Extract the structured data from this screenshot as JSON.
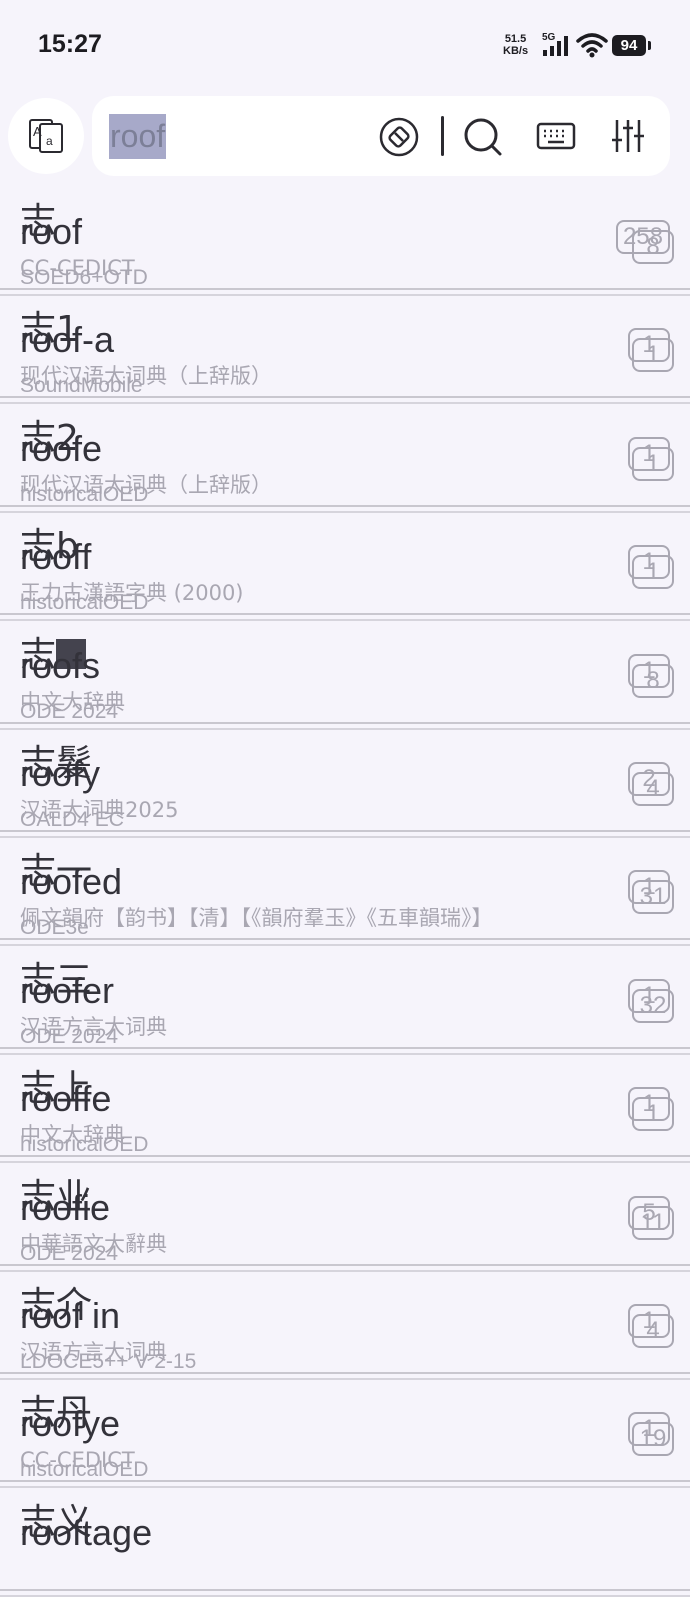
{
  "status_bar": {
    "time": "15:27",
    "net_speed_value": "51.5",
    "net_speed_unit": "KB/s",
    "signal_label": "5G",
    "battery": "94"
  },
  "search": {
    "query": "roof"
  },
  "results": [
    {
      "ghost_headword": "志",
      "headword": "roof",
      "ghost_dict": "CC-CEDICT",
      "dict": "SOED6+OTD",
      "ghost_count": "258",
      "count": "8"
    },
    {
      "ghost_headword": "志1",
      "headword": "roof-a",
      "ghost_dict": "现代汉语大词典（上辞版）",
      "dict": "SoundMobile",
      "ghost_count": "1",
      "count": "1"
    },
    {
      "ghost_headword": "志2",
      "headword": "roofe",
      "ghost_dict": "现代汉语大词典（上辞版）",
      "dict": "historicalOED",
      "ghost_count": "1",
      "count": "1"
    },
    {
      "ghost_headword": "志b",
      "headword": "rooff",
      "ghost_dict": "王力古漢語字典 (2000)",
      "dict": "historicalOED",
      "ghost_count": "1",
      "count": "1"
    },
    {
      "ghost_headword": "志",
      "ghost_square": true,
      "headword": "roofs",
      "ghost_dict": "中文大辞典",
      "dict": "ODE 2024",
      "ghost_count": "1",
      "count": "8"
    },
    {
      "ghost_headword": "志髮",
      "headword": "roofy",
      "ghost_dict": "汉语大词典2025",
      "dict": "OALD4 EC",
      "ghost_count": "2",
      "count": "4"
    },
    {
      "ghost_headword": "志一",
      "headword": "roofed",
      "ghost_dict": "佩文韻府【韵书】【清】【《韻府羣玉》《五車韻瑞》】",
      "dict": "ODE3e",
      "ghost_count": "1",
      "count": "31"
    },
    {
      "ghost_headword": "志三",
      "headword": "roofer",
      "ghost_dict": "汉语方言大词典",
      "dict": "ODE 2024",
      "ghost_count": "1",
      "count": "32"
    },
    {
      "ghost_headword": "志上",
      "headword": "rooffe",
      "ghost_dict": "中文大辞典",
      "dict": "historicalOED",
      "ghost_count": "1",
      "count": "1"
    },
    {
      "ghost_headword": "志业",
      "headword": "roofie",
      "ghost_dict": "中華語文大辭典",
      "dict": "ODE 2024",
      "ghost_count": "5",
      "count": "11"
    },
    {
      "ghost_headword": "志介",
      "headword": "roof in",
      "ghost_dict": "汉语方言大词典",
      "dict": "LDOCE5++ V 2-15",
      "ghost_count": "1",
      "count": "4"
    },
    {
      "ghost_headword": "志丹",
      "headword": "roofye",
      "ghost_dict": "CC-CEDICT",
      "dict": "historicalOED",
      "ghost_count": "1",
      "count": "19"
    },
    {
      "ghost_headword": "志义",
      "headword": "rooftage",
      "ghost_dict": "",
      "dict": "",
      "ghost_count": "",
      "count": ""
    }
  ],
  "icons": {
    "toggle": "language-toggle-icon",
    "clear": "clear-eraser-icon",
    "search": "search-icon",
    "keyboard": "keyboard-icon",
    "filter": "sliders-icon"
  },
  "colors": {
    "background": "#f6f4fb",
    "selection": "#a7a9c9",
    "muted": "#a9a7b2"
  }
}
